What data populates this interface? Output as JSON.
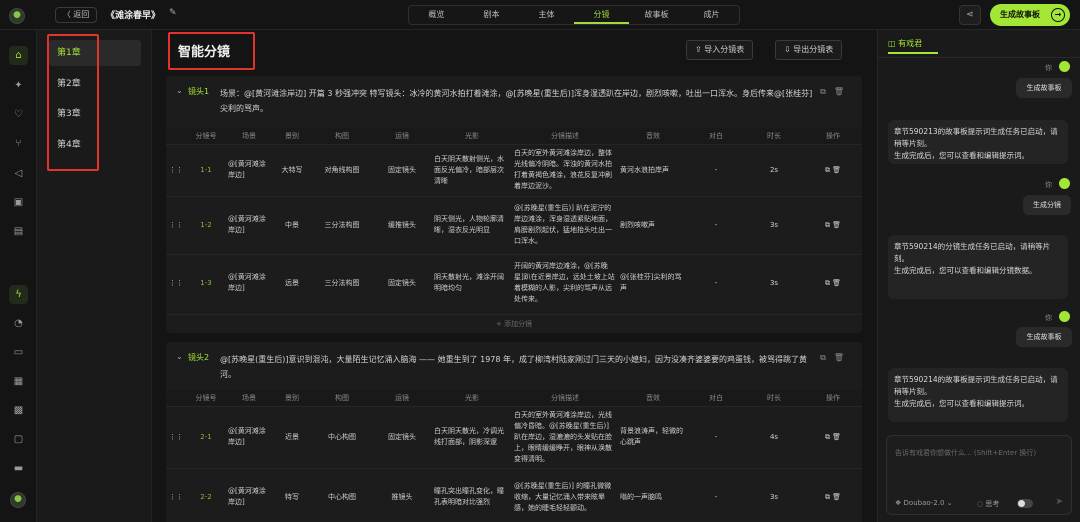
{
  "header": {
    "back_label": "〈 返回",
    "project_title": "《滩涂春早》",
    "tabs": [
      "概览",
      "剧本",
      "主体",
      "分镜",
      "故事板",
      "成片"
    ],
    "active_tab": "分镜",
    "generate_button": "生成故事板",
    "accent_color": "#a3e635"
  },
  "rail_icons": [
    "home-icon",
    "sparkle-icon",
    "heart-icon",
    "branch-icon",
    "megaphone-icon",
    "briefcase-icon",
    "wallet-icon",
    "bolt-icon",
    "bell-icon",
    "book-icon",
    "qrcode-icon",
    "gift-icon",
    "chat-icon",
    "card-icon"
  ],
  "chapters": [
    "第1章",
    "第2章",
    "第3章",
    "第4章"
  ],
  "main": {
    "title": "智能分镜",
    "import_button": "导入分镜表",
    "export_button": "导出分镜表",
    "columns": [
      "分镜号",
      "场景",
      "景别",
      "构图",
      "运镜",
      "光影",
      "分镜描述",
      "音效",
      "对白",
      "时长",
      "操作"
    ],
    "add_row_label": "+ 添加分镜",
    "shots": [
      {
        "label": "镜头1",
        "scene": "场景：@[黄河滩涂岸边] 开篇 3 秒强冲突 特写镜头：冰冷的黄河水拍打着滩涂，@[苏晚星(重生后)]浑身湿透趴在岸边，剧烈咳嗽，吐出一口浑水。身后传来@[张桂芬]尖利的骂声。",
        "rows": [
          {
            "no": "1-1",
            "scene": "@[黄河滩涂岸边]",
            "shot": "大特写",
            "comp": "对角线构图",
            "move": "固定镜头",
            "light": "白天阴天散射侧光，水面反光偏冷，暗部层次清晰",
            "desc": "白天的室外黄河滩涂岸边，整体光线偏冷阴暗。浑浊的黄河水拍打着黄褐色滩涂，浪花反复冲刷着岸边泥沙。",
            "sfx": "黄河水浪拍岸声",
            "dialog": "-",
            "dur": "2s"
          },
          {
            "no": "1-2",
            "scene": "@[黄河滩涂岸边]",
            "shot": "中景",
            "comp": "三分法构图",
            "move": "缓推镜头",
            "light": "阴天侧光，人物轮廓清晰，湿衣反光明显",
            "desc": "@[苏晚星(重生后)] 趴在泥泞的岸边滩涂，浑身湿透紧贴地面，肩膀剧烈起伏，猛地抬头吐出一口浑水。",
            "sfx": "剧烈咳嗽声",
            "dialog": "-",
            "dur": "3s"
          },
          {
            "no": "1-3",
            "scene": "@[黄河滩涂岸边]",
            "shot": "远景",
            "comp": "三分法构图",
            "move": "固定镜头",
            "light": "阴天散射光，滩涂开阔明暗均匀",
            "desc": "开阔的黄河岸边滩涂，@[苏晚星]趴在近景岸边，远处土坡上站着模糊的人影，尖利的骂声从远处传来。",
            "sfx": "@[张桂芬]尖利的骂声",
            "dialog": "-",
            "dur": "3s"
          }
        ]
      },
      {
        "label": "镜头2",
        "scene": "@[苏晚星(重生后)]意识到混沌，大量陌生记忆涌入脑海 —— 她重生到了 1978 年，成了柳湾村陆家刚过门三天的小媳妇，因为没凑齐婆婆要的鸡蛋钱，被骂得跳了黄河。",
        "rows": [
          {
            "no": "2-1",
            "scene": "@[黄河滩涂岸边]",
            "shot": "近景",
            "comp": "中心构图",
            "move": "固定镜头",
            "light": "白天阴天散光，冷调光线打面部，阴影深邃",
            "desc": "白天的室外黄河滩涂岸边，光线偏冷昏暗。@[苏晚星(重生后)] 趴在岸边，湿漉漉的头发贴在脸上，眼睛缓缓睁开，眼神从涣散变得清明。",
            "sfx": "背景浪涛声，轻微的心跳声",
            "dialog": "-",
            "dur": "4s"
          },
          {
            "no": "2-2",
            "scene": "@[黄河滩涂岸边]",
            "shot": "特写",
            "comp": "中心构图",
            "move": "推镜头",
            "light": "瞳孔突出瞳孔变化，瞳孔表明暗对比强烈",
            "desc": "@[苏晚星(重生后)] 的瞳孔微微收缩，大量记忆涌入带来眩晕感，她的睫毛轻轻颤动。",
            "sfx": "嗡的一声脑鸣",
            "dialog": "-",
            "dur": "3s"
          }
        ]
      }
    ]
  },
  "chat": {
    "title": "有戏君",
    "you_label": "你",
    "messages": [
      {
        "role": "user",
        "text": "生成故事板"
      },
      {
        "role": "system",
        "lines": [
          "章节590213的故事板提示词生成任务已启动，请稍等片刻。",
          "生成完成后，您可以查看和编辑提示词。"
        ]
      },
      {
        "role": "user",
        "text": "生成分镜"
      },
      {
        "role": "system",
        "lines": [
          "章节590214的分镜生成任务已启动，请稍等片刻。",
          "生成完成后，您可以查看和编辑分镜数据。"
        ]
      },
      {
        "role": "user",
        "text": "生成故事板"
      },
      {
        "role": "system",
        "lines": [
          "章节590214的故事板提示词生成任务已启动，请稍等片刻。",
          "生成完成后，您可以查看和编辑提示词。"
        ]
      }
    ],
    "input_placeholder": "告诉有戏君你想做什么... (Shift+Enter 换行)",
    "model": "Doubao-2.0 ⌄",
    "think_label": "思考"
  }
}
